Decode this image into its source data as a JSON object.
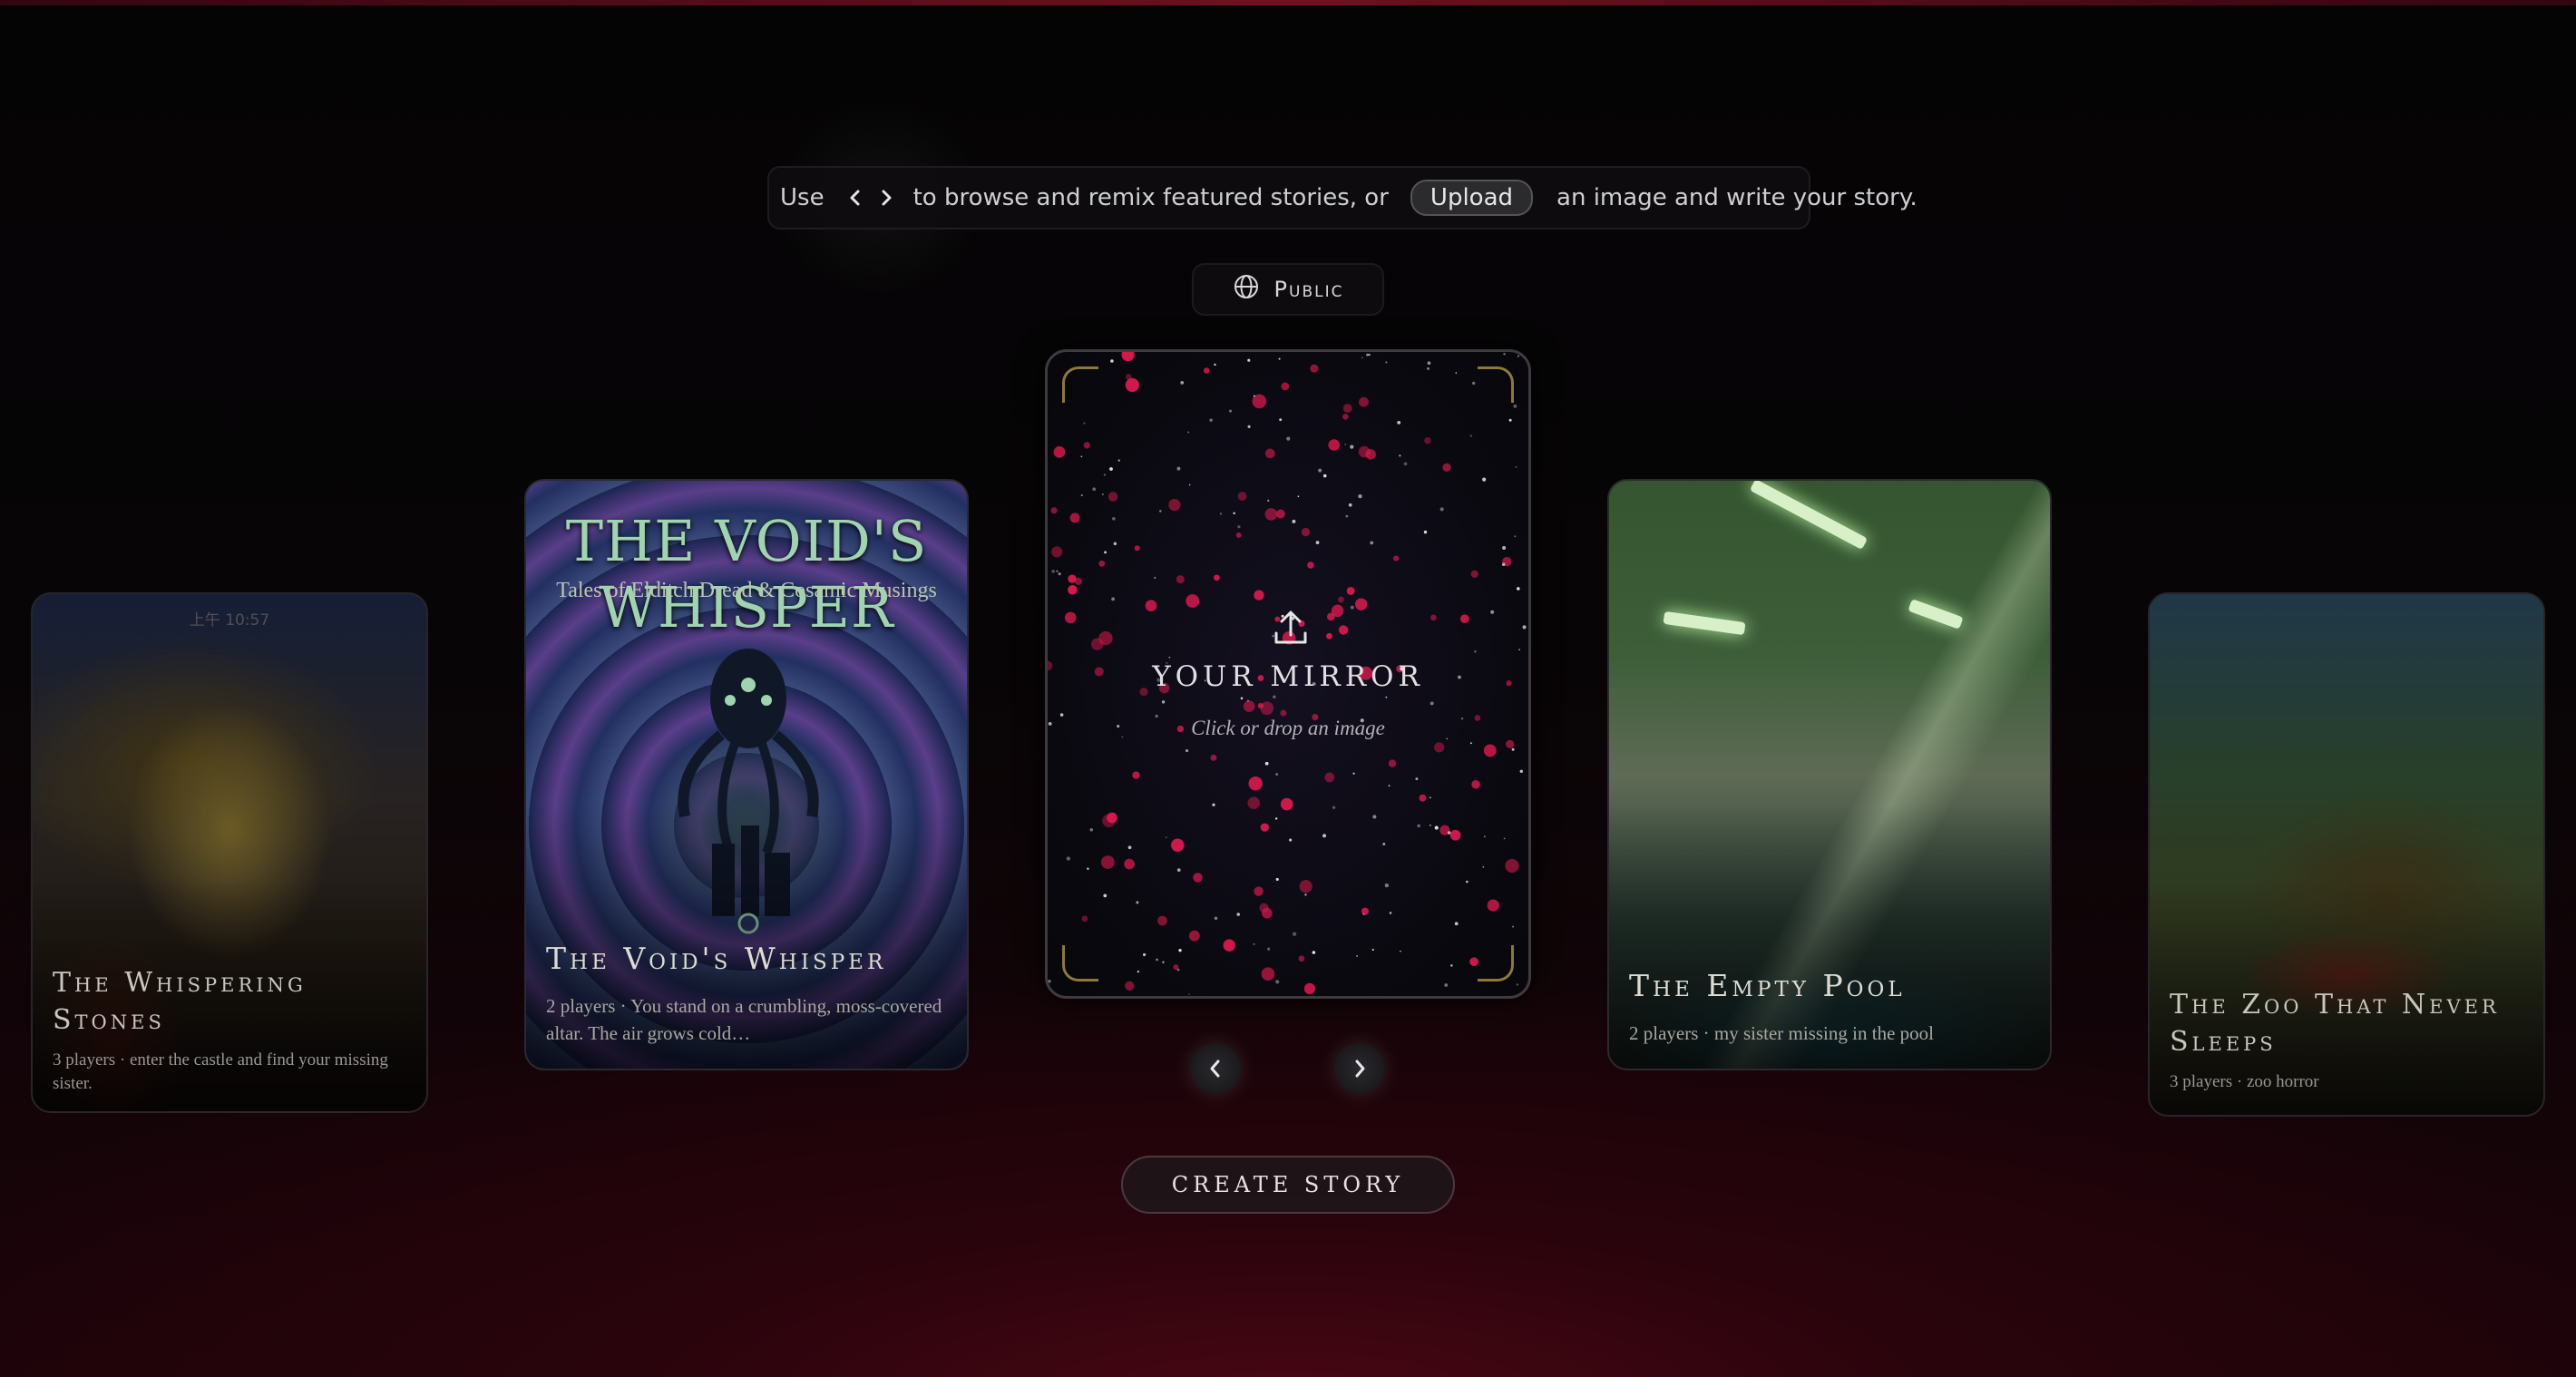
{
  "hint": {
    "prefix": "Use",
    "middle": "to browse and remix featured stories, or",
    "upload_label": "Upload",
    "suffix": "an image and write your story."
  },
  "visibility": {
    "label": "Public",
    "icon": "globe-icon"
  },
  "mirror": {
    "title": "YOUR MIRROR",
    "subtitle": "Click or drop an image",
    "icon": "upload-icon"
  },
  "stories": [
    {
      "title": "The Whispering Stones",
      "subtitle": "3 players · enter the castle and find your missing sister.",
      "status_text": "上午 10:57"
    },
    {
      "title": "The Void's Whisper",
      "subtitle": "2 players · You stand on a crumbling, moss-covered altar. The air grows cold…",
      "cover_title": "THE VOID'S WHISPER",
      "cover_subtitle": "Tales of Elditch Dread & Cosamic Musings"
    },
    {
      "title": "The Empty Pool",
      "subtitle": "2 players · my sister missing in the pool"
    },
    {
      "title": "The Zoo That Never Sleeps",
      "subtitle": "3 players · zoo horror"
    }
  ],
  "nav": {
    "prev_icon": "chevron-left-icon",
    "next_icon": "chevron-right-icon"
  },
  "actions": {
    "create_label": "CREATE STORY"
  },
  "colors": {
    "accent_red": "#e01a4f",
    "background": "#050405",
    "gold_corner": "#8c7a3a"
  }
}
